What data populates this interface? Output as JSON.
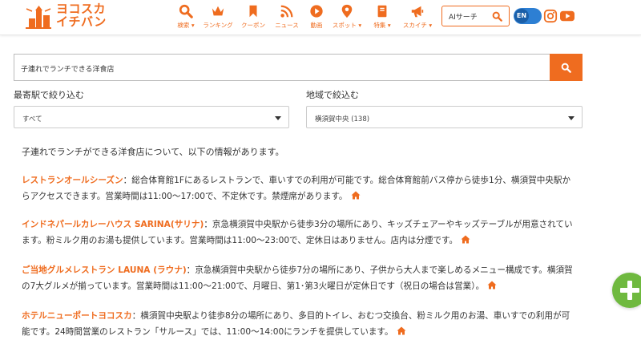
{
  "header": {
    "logo_line1": "ヨコスカ",
    "logo_line2": "イチバン",
    "nav": [
      {
        "label": "検索",
        "chevron": "▾",
        "icon": "search-icon"
      },
      {
        "label": "ランキング",
        "chevron": "",
        "icon": "crown-icon"
      },
      {
        "label": "クーポン",
        "chevron": "",
        "icon": "bookmark-icon"
      },
      {
        "label": "ニュース",
        "chevron": "",
        "icon": "rss-icon"
      },
      {
        "label": "動画",
        "chevron": "",
        "icon": "play-icon"
      },
      {
        "label": "スポット",
        "chevron": "▾",
        "icon": "map-pin-icon"
      },
      {
        "label": "特集",
        "chevron": "▾",
        "icon": "book-icon"
      },
      {
        "label": "スカイチ",
        "chevron": "▾",
        "icon": "megaphone-icon"
      }
    ],
    "ai_search_label": "AIサーチ",
    "lang_label": "EN"
  },
  "search": {
    "query": "子連れでランチできる洋食店"
  },
  "filters": {
    "station": {
      "label": "最寄駅で絞り込む",
      "value": "すべて"
    },
    "area": {
      "label": "地域で絞込む",
      "value": "横須賀中央 (138)"
    }
  },
  "intro": "子連れでランチができる洋食店について、以下の情報があります。",
  "results": [
    {
      "name": "レストランオールシーズン",
      "text": "：総合体育館1Fにあるレストランで、車いすでの利用が可能です。総合体育館前バス停から徒歩1分、横須賀中央駅からアクセスできます。営業時間は11:00～17:00で、不定休です。禁煙席があります。"
    },
    {
      "name": "インドネパールカレーハウス SARINA(サリナ)",
      "text": "：京急横須賀中央駅から徒歩3分の場所にあり、キッズチェアーやキッズテーブルが用意されています。粉ミルク用のお湯も提供しています。営業時間は11:00～23:00で、定休日はありません。店内は分煙です。"
    },
    {
      "name": "ご当地グルメレストラン LAUNA (ラウナ)",
      "text": "：京急横須賀中央駅から徒歩7分の場所にあり、子供から大人まで楽しめるメニュー構成です。横須賀の7大グルメが揃っています。営業時間は11:00～21:00で、月曜日、第1･第3火曜日が定休日です（祝日の場合は営業）。"
    },
    {
      "name": "ホテルニューポートヨコスカ",
      "text": "：横須賀中央駅より徒歩8分の場所にあり、多目的トイレ、おむつ交換台、粉ミルク用のお湯、車いすでの利用が可能です。24時間営業のレストラン「サルース」では、11:00～14:00にランチを提供しています。"
    }
  ],
  "colors": {
    "accent": "#ef6c1f",
    "fab": "#6fb93f",
    "toggle": "#2d7fd3"
  }
}
